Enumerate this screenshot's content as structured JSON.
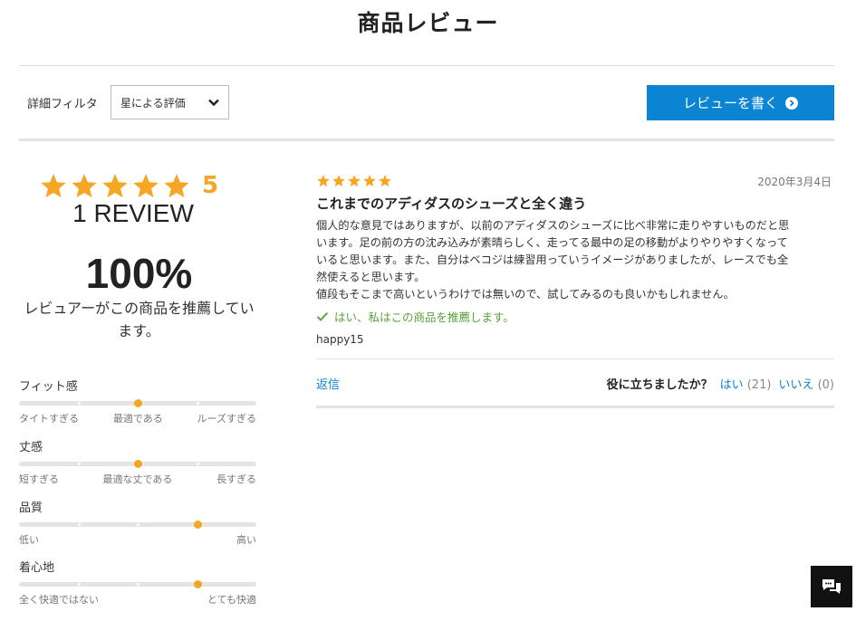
{
  "page": {
    "title": "商品レビュー"
  },
  "filter": {
    "label": "詳細フィルタ",
    "select_value": "星による評価"
  },
  "write_button": {
    "label": "レビューを書く"
  },
  "summary": {
    "rating": 5,
    "rating_label": "5",
    "review_count": "1 REVIEW",
    "recommend_percent": "100%",
    "recommend_text": "レビュアーがこの商品を推薦しています。",
    "star_color": "#f5a623"
  },
  "attributes": [
    {
      "name": "フィット感",
      "scale": [
        "タイトすぎる",
        "最適である",
        "ルーズすぎる"
      ],
      "value_fraction": 0.5
    },
    {
      "name": "丈感",
      "scale": [
        "短すぎる",
        "最適な丈である",
        "長すぎる"
      ],
      "value_fraction": 0.5
    },
    {
      "name": "品質",
      "scale": [
        "低い",
        "高い"
      ],
      "value_fraction": 0.75
    },
    {
      "name": "着心地",
      "scale": [
        "全く快適ではない",
        "とても快適"
      ],
      "value_fraction": 0.75
    }
  ],
  "review": {
    "stars": 5,
    "date": "2020年3月4日",
    "title": "これまでのアディダスのシューズと全く違う",
    "body_lines": [
      "個人的な意見ではありますが、以前のアディダスのシューズに比べ非常に走りやすいものだと思",
      "います。足の前の方の沈み込みが素晴らしく、走ってる最中の足の移動がよりやりやすくなって",
      "いると思います。また、自分はベコジは練習用っていうイメージがありましたが、レースでも全",
      "然使えると思います。",
      "値段もそこまで高いというわけでは無いので、試してみるのも良いかもしれません。"
    ],
    "recommend": "はい、私はこの商品を推薦します。",
    "author": "happy15",
    "reply_label": "返信",
    "helpful_question": "役に立ちましたか？",
    "helpful_yes": "はい",
    "helpful_yes_count": "(21)",
    "helpful_no": "いいえ",
    "helpful_no_count": "(0)"
  },
  "colors": {
    "accent": "#0b84d3",
    "star": "#f5a623",
    "recommend": "#5aa23a"
  }
}
